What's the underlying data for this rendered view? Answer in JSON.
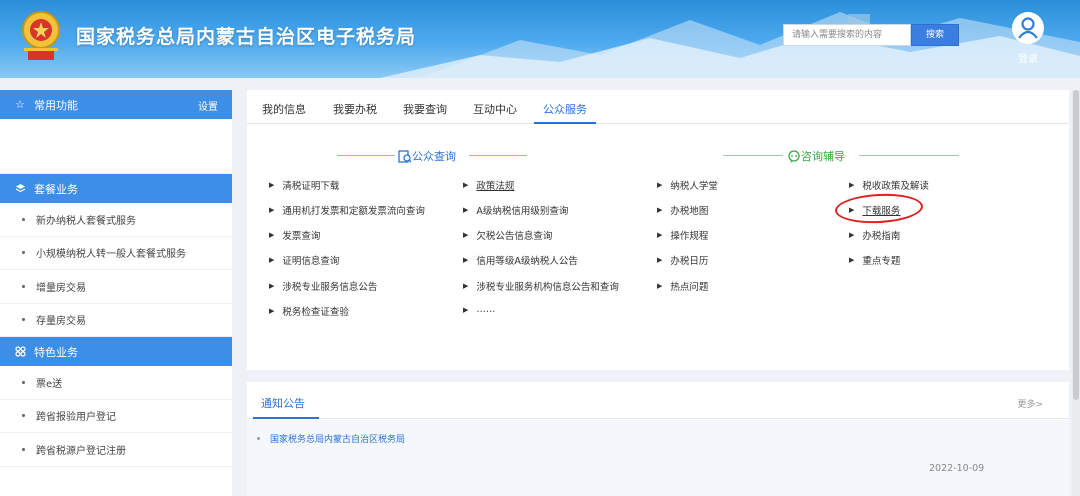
{
  "header": {
    "site_title": "国家税务总局内蒙古自治区电子税务局",
    "search_placeholder": "请输入需要搜索的内容",
    "search_button": "搜索",
    "login_label": "登录"
  },
  "sidebar": {
    "common": {
      "title": "常用功能",
      "setting": "设置",
      "icon": "star-icon"
    },
    "package": {
      "title": "套餐业务",
      "icon": "layers-icon",
      "items": [
        "新办纳税人套餐式服务",
        "小规模纳税人转一般人套餐式服务",
        "增量房交易",
        "存量房交易"
      ]
    },
    "special": {
      "title": "特色业务",
      "icon": "grid-icon",
      "items": [
        "票e送",
        "跨省报验用户登记",
        "跨省税源户登记注册"
      ]
    }
  },
  "tabs": [
    "我的信息",
    "我要办税",
    "我要查询",
    "互动中心",
    "公众服务"
  ],
  "active_tab": "公众服务",
  "public_query": {
    "title": "公众查询",
    "col1": [
      "清税证明下载",
      "通用机打发票和定额发票流向查询",
      "发票查询",
      "证明信息查询",
      "涉税专业服务信息公告",
      "税务检查证查验"
    ],
    "col2": [
      "政策法规",
      "A级纳税信用级别查询",
      "欠税公告信息查询",
      "信用等级A级纳税人公告",
      "涉税专业服务机构信息公告和查询",
      "……"
    ]
  },
  "consult_guide": {
    "title": "咨询辅导",
    "col3": [
      "纳税人学堂",
      "办税地图",
      "操作规程",
      "办税日历",
      "热点问题"
    ],
    "col4": [
      "税收政策及解读",
      "下载服务",
      "办税指南",
      "重点专题"
    ]
  },
  "notice": {
    "tab": "通知公告",
    "more": "更多>",
    "item": "国家税务总局内蒙古自治区税务局",
    "date": "2022-10-09"
  },
  "colors": {
    "accent": "#2b73d8",
    "header": "#2a8fd8",
    "green": "#3aa54a",
    "annotation": "#e02020"
  }
}
